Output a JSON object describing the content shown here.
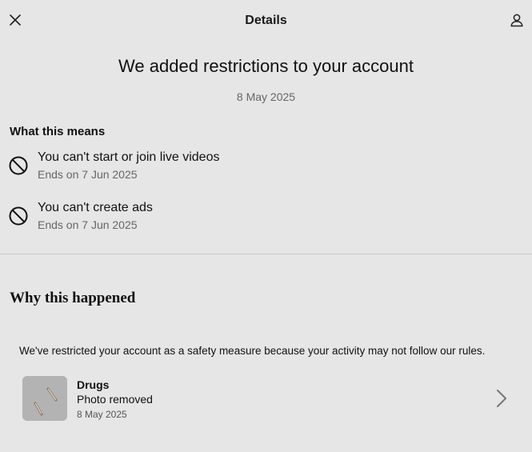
{
  "header": {
    "title": "Details"
  },
  "notice": {
    "title": "We added restrictions to your account",
    "date": "8 May 2025"
  },
  "what_this_means": {
    "heading": "What this means",
    "items": [
      {
        "title": "You can't start or join live videos",
        "ends": "Ends on 7 Jun 2025",
        "icon": "prohibited-icon"
      },
      {
        "title": "You can't create ads",
        "ends": "Ends on 7 Jun 2025",
        "icon": "prohibited-icon"
      }
    ]
  },
  "why": {
    "heading": "Why this happened",
    "text": "We've restricted your account as a safety measure because your activity may not follow our rules.",
    "violation": {
      "title": "Drugs",
      "status": "Photo removed",
      "date": "8 May 2025"
    }
  },
  "colors": {
    "background": "#e6e6e6",
    "secondary_text": "#666666",
    "divider": "#c9c9c9"
  }
}
